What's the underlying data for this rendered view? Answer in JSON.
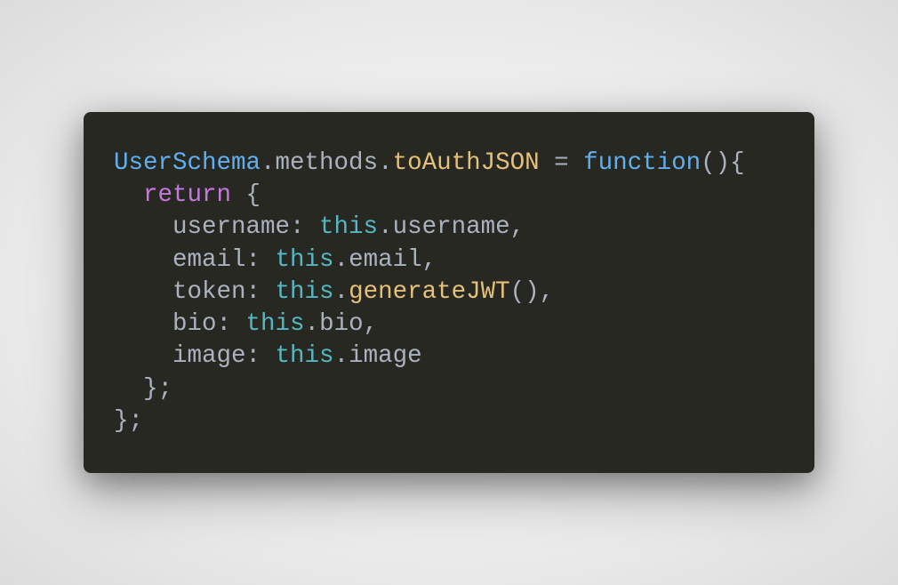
{
  "code": {
    "line1": {
      "class": "UserSchema",
      "dot1": ".",
      "prop": "methods",
      "dot2": ".",
      "method": "toAuthJSON",
      "assign": " = ",
      "fn": "function",
      "paren": "(){"
    },
    "line2": {
      "indent": "  ",
      "ret": "return",
      "brace": " {"
    },
    "line3": {
      "indent": "    ",
      "key": "username: ",
      "this": "this",
      "dot": ".",
      "prop": "username",
      "comma": ","
    },
    "line4": {
      "indent": "    ",
      "key": "email: ",
      "this": "this",
      "dot": ".",
      "prop": "email",
      "comma": ","
    },
    "line5": {
      "indent": "    ",
      "key": "token: ",
      "this": "this",
      "dot": ".",
      "func": "generateJWT",
      "paren": "(),"
    },
    "line6": {
      "indent": "    ",
      "key": "bio: ",
      "this": "this",
      "dot": ".",
      "prop": "bio",
      "comma": ","
    },
    "line7": {
      "indent": "    ",
      "key": "image: ",
      "this": "this",
      "dot": ".",
      "prop": "image"
    },
    "line8": {
      "indent": "  ",
      "close": "};"
    },
    "line9": {
      "close": "};"
    }
  }
}
